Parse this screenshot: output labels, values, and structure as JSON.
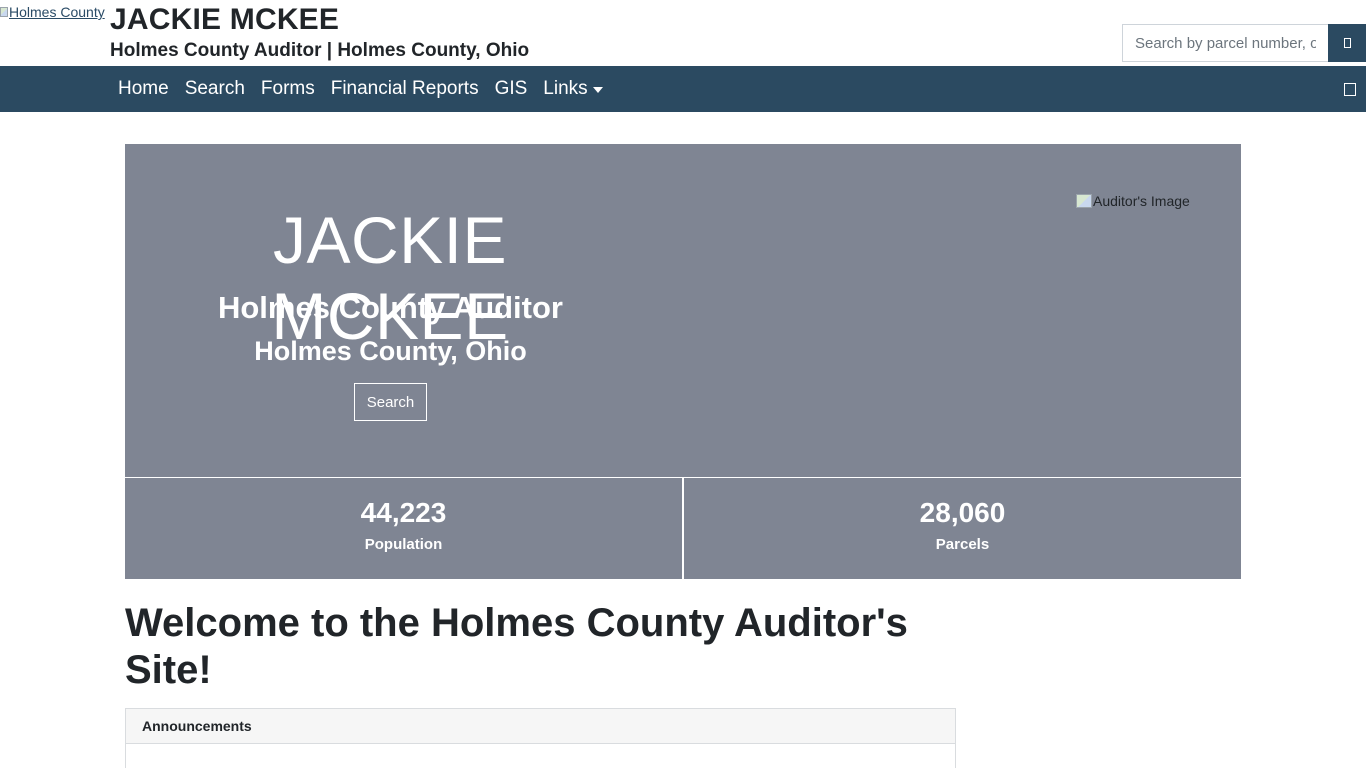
{
  "header": {
    "logo_alt": "Holmes County",
    "title": "JACKIE MCKEE",
    "subtitle": "Holmes County Auditor | Holmes County, Ohio",
    "search": {
      "placeholder": "Search by parcel number, owner name, address",
      "button_icon": "search-icon"
    }
  },
  "nav": {
    "items": [
      {
        "label": "Home"
      },
      {
        "label": "Search"
      },
      {
        "label": "Forms"
      },
      {
        "label": "Financial Reports"
      },
      {
        "label": "GIS"
      },
      {
        "label": "Links"
      }
    ],
    "toggle_icon": "menu-toggle-icon"
  },
  "hero": {
    "name": "JACKIE MCKEE",
    "role": "Holmes County Auditor",
    "location": "Holmes County, Ohio",
    "button_label": "Search",
    "image_alt": "Auditor's Image"
  },
  "stats": {
    "population": {
      "value": "44,223",
      "label": "Population"
    },
    "parcels": {
      "value": "28,060",
      "label": "Parcels"
    }
  },
  "main": {
    "welcome": "Welcome to the Holmes County Auditor's Site!",
    "announcements_title": "Announcements"
  },
  "colors": {
    "brand_navy": "#2b4a61",
    "hero_gray": "#7f8593"
  }
}
